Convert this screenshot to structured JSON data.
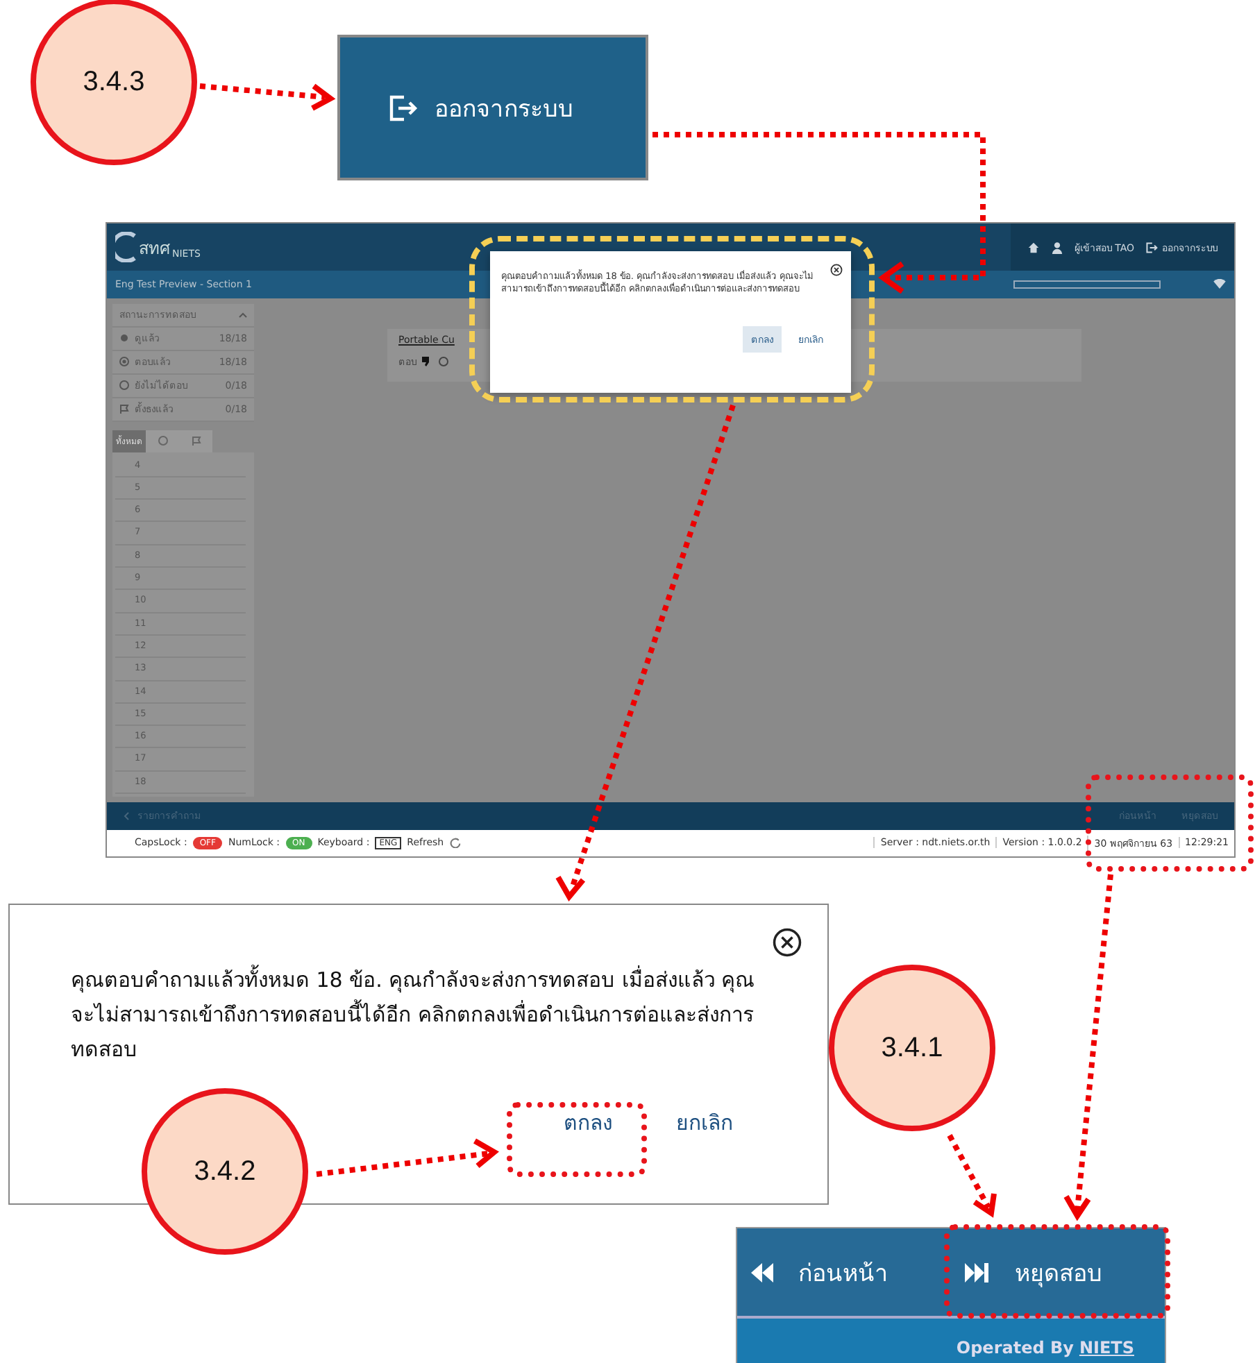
{
  "callouts": [
    {
      "label": "3.4.3"
    },
    {
      "label": "3.4.2"
    },
    {
      "label": "3.4.1"
    }
  ],
  "logout_crop": {
    "label": "ออกจากระบบ"
  },
  "screenshot": {
    "header": {
      "logo": "สทศ",
      "logo_sub": "NIETS",
      "user": "ผู้เข้าสอบ TAO",
      "logout": "ออกจากระบบ"
    },
    "title": "Eng Test Preview - Section 1",
    "sidebar": {
      "title": "สถานะการทดสอบ",
      "statuses": [
        {
          "kind": "viewed",
          "label": "ดูแล้ว",
          "count": "18/18"
        },
        {
          "kind": "answered",
          "label": "ตอบแล้ว",
          "count": "18/18"
        },
        {
          "kind": "unanswered",
          "label": "ยังไม่ได้ตอบ",
          "count": "0/18"
        },
        {
          "kind": "flagged",
          "label": "ตั้งธงแล้ว",
          "count": "0/18"
        }
      ],
      "tabs": [
        {
          "kind": "all",
          "label": "ทั้งหมด",
          "selected": true
        },
        {
          "kind": "circle",
          "selected": false
        },
        {
          "kind": "flag",
          "selected": false
        }
      ],
      "questions": [
        "4",
        "5",
        "6",
        "7",
        "8",
        "9",
        "10",
        "11",
        "12",
        "13",
        "14",
        "15",
        "16",
        "17",
        "18"
      ]
    },
    "question_title": "Portable Cu",
    "answer_label": "ตอบ",
    "dialog": {
      "message": "คุณตอบคำถามแล้วทั้งหมด 18 ข้อ. คุณกำลังจะส่งการทดสอบ เมื่อส่งแล้ว คุณจะไม่สามารถเข้าถึงการทดสอบนี้ได้อีก คลิกตกลงเพื่อดำเนินการต่อและส่งการทดสอบ",
      "ok": "ตกลง",
      "cancel": "ยกเลิก"
    },
    "footer_nav": {
      "back": "รายการคำถาม",
      "prev": "ก่อนหน้า",
      "stop": "หยุดสอบ"
    },
    "status_bar": {
      "capslock": {
        "label": "CapsLock :",
        "text": "OFF",
        "on": false
      },
      "numlock": {
        "label": "NumLock :",
        "text": "ON",
        "on": true
      },
      "keyboard": "Keyboard :",
      "lang": "ENG",
      "refresh": "Refresh",
      "server": "Server : ndt.niets.or.th",
      "version": "Version : 1.0.0.2",
      "date": "30 พฤศจิกายน 63",
      "time": "12:29:21"
    }
  },
  "zoom_dialog": {
    "message": "คุณตอบคำถามแล้วทั้งหมด 18 ข้อ. คุณกำลังจะส่งการทดสอบ เมื่อส่งแล้ว คุณจะไม่สามารถเข้าถึงการทดสอบนี้ได้อีก คลิกตกลงเพื่อดำเนินการต่อและส่งการทดสอบ",
    "ok": "ตกลง",
    "cancel": "ยกเลิก"
  },
  "nav_crop": {
    "prev": "ก่อนหน้า",
    "stop": "หยุดสอบ",
    "operated": "Operated By",
    "brand": "NIETS"
  }
}
